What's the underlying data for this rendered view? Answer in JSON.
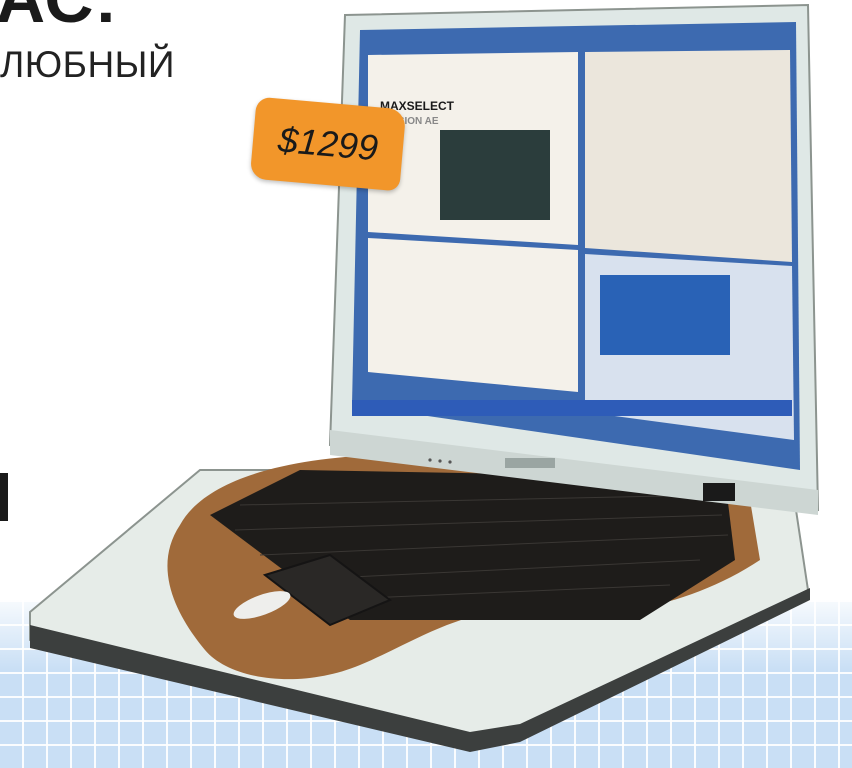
{
  "headline": {
    "top_line": "АС:",
    "sub_line": "ЛЮБНЫЙ"
  },
  "price_tag": {
    "text": "$1299",
    "color": "#f2962a"
  },
  "screen": {
    "heading": "MAXSELECT",
    "subheading": "MISSION AE"
  },
  "colors": {
    "background_grid": "#c9dff5",
    "laptop_body": "#e6ece8",
    "wood_trim": "#a06a3a",
    "keyboard": "#1e1c1a"
  }
}
